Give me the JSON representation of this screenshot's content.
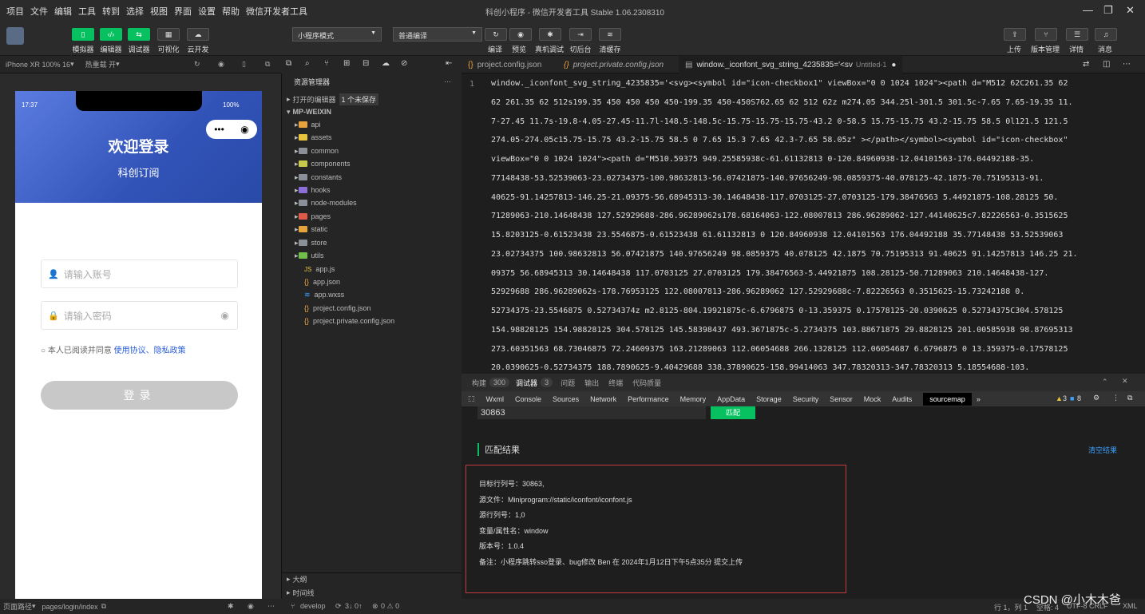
{
  "menu": {
    "items": [
      "项目",
      "文件",
      "编辑",
      "工具",
      "转到",
      "选择",
      "视图",
      "界面",
      "设置",
      "帮助",
      "微信开发者工具"
    ],
    "title": "科创小程序 - 微信开发者工具 Stable 1.06.2308310"
  },
  "toolbar": {
    "simulator": "模拟器",
    "editor": "编辑器",
    "debugger": "调试器",
    "visual": "可视化",
    "cloud": "云开发",
    "mode": "小程序模式",
    "compile": "普通编译",
    "comp": "编译",
    "preview": "预览",
    "realdebug": "真机调试",
    "bg": "切后台",
    "cache": "清缓存",
    "upload": "上传",
    "version": "版本管理",
    "detail": "详情",
    "msg": "消息"
  },
  "simbar": {
    "device": "iPhone XR 100% 16",
    "hot": "热重载 开"
  },
  "phone": {
    "time": "17:37",
    "battery": "100%",
    "title": "欢迎登录",
    "subtitle": "科创订阅",
    "account_placeholder": "请输入账号",
    "password_placeholder": "请输入密码",
    "agree_prefix": "本人已阅读并同意",
    "agree_links": "使用协议、隐私政策",
    "login": "登录"
  },
  "explorer": {
    "header": "资源管理器",
    "open_editors": "打开的编辑器",
    "unsaved": "1 个未保存",
    "root": "MP-WEIXIN",
    "folders": [
      "api",
      "assets",
      "common",
      "components",
      "constants",
      "hooks",
      "node-modules",
      "pages",
      "static",
      "store",
      "utils"
    ],
    "files": [
      "app.js",
      "app.json",
      "app.wxss",
      "project.config.json",
      "project.private.config.json"
    ],
    "outline": "大纲",
    "timeline": "时间线"
  },
  "tabs": [
    "project.config.json",
    "project.private.config.json",
    "window._iconfont_svg_string_4235835='<sv",
    "Untitled-1"
  ],
  "code": {
    "line": "1",
    "lines": [
      "window._iconfont_svg_string_4235835='<svg><symbol id=\"icon-checkbox1\" viewBox=\"0 0 1024 1024\"><path d=\"M512 62C261.35 62",
      "62 261.35 62 512s199.35 450 450 450 450-199.35 450-450S762.65 62 512 62z m274.05 344.25l-301.5 301.5c-7.65 7.65-19.35 11.",
      "7-27.45 11.7s-19.8-4.05-27.45-11.7l-148.5-148.5c-15.75-15.75-15.75-43.2 0-58.5 15.75-15.75 43.2-15.75 58.5 0l121.5 121.5",
      "274.05-274.05c15.75-15.75 43.2-15.75 58.5 0 7.65 15.3 7.65 42.3-7.65 58.05z\"  ></path></symbol><symbol id=\"icon-checkbox\"",
      "viewBox=\"0 0 1024 1024\"><path d=\"M510.59375 949.25585938c-61.61132813 0-120.84960938-12.04101563-176.04492188-35.",
      "77148438-53.52539063-23.02734375-100.98632813-56.07421875-140.97656249-98.0859375-40.078125-42.1875-70.75195313-91.",
      "40625-91.14257813-146.25-21.09375-56.68945313-30.14648438-117.0703125-27.0703125-179.38476563 5.44921875-108.28125 50.",
      "71289063-210.14648438 127.52929688-286.96289062s178.68164063-122.08007813 286.96289062-127.44140625c7.82226563-0.3515625",
      "15.8203125-0.61523438 23.5546875-0.61523438 61.61132813 0 120.84960938 12.04101563 176.04492188 35.77148438 53.52539063",
      "23.02734375 100.98632813 56.07421875 140.97656249 98.0859375 40.078125 42.1875 70.75195313 91.40625 91.14257813 146.25 21.",
      "09375 56.68945313 30.14648438 117.0703125 27.0703125 179.38476563-5.44921875 108.28125-50.71289063 210.14648438-127.",
      "52929688 286.96289062s-178.76953125 122.08007813-286.96289062 127.52929688c-7.82226563 0.3515625-15.73242188 0.",
      "52734375-23.5546875 0.52734374z m2.8125-804.19921875c-6.6796875 0-13.359375 0.17578125-20.0390625 0.52734375C304.578125",
      "154.98828125 154.98828125 304.578125 145.58398437 493.3671875c-5.2734375 103.88671875 29.8828125 201.00585938 98.87695313",
      "273.60351563 68.73046875 72.24609375 163.21289063 112.06054688 266.1328125 112.06054687 6.6796875 0 13.359375-0.17578125",
      "20.0390625-0.52734375 188.7890625-9.40429688 338.37890625-158.99414063 347.78320313-347.78320313 5.18554688-103."
    ]
  },
  "panel": {
    "tabs1": [
      "构建",
      "300",
      "调试器",
      "3",
      "问题",
      "输出",
      "终端",
      "代码质量"
    ],
    "tabs2": [
      "Wxml",
      "Console",
      "Sources",
      "Network",
      "Performance",
      "Memory",
      "AppData",
      "Storage",
      "Security",
      "Sensor",
      "Mock",
      "Audits",
      "sourcemap"
    ],
    "warn": "3",
    "err": "8"
  },
  "sourcemap": {
    "line_input": "30863",
    "match": "匹配",
    "result_title": "匹配结果",
    "clear": "清空结果",
    "results": [
      "目标行列号：30863,",
      "源文件：Miniprogram://static/iconfont/iconfont.js",
      "源行列号：1,0",
      "变量/属性名：window",
      "版本号：1.0.4",
      "备注：小程序跳转sso登录、bug修改 Ben 在 2024年1月12日下午5点35分 提交上传"
    ]
  },
  "status": {
    "path": "页面路径",
    "page": "pages/login/index",
    "branch": "develop",
    "sync": "3↓ 0↑",
    "errors": "0 ⚠ 0",
    "pos": "行 1，列 1",
    "space": "空格: 4",
    "enc": "UTF-8",
    "eol": "CRLF",
    "lang": "XML"
  },
  "watermark": "CSDN @小木木爸",
  "colors": {
    "accent": "#07c160",
    "hero": "#3153b8",
    "link": "#2b5fd9",
    "border": "#c23b3b"
  }
}
